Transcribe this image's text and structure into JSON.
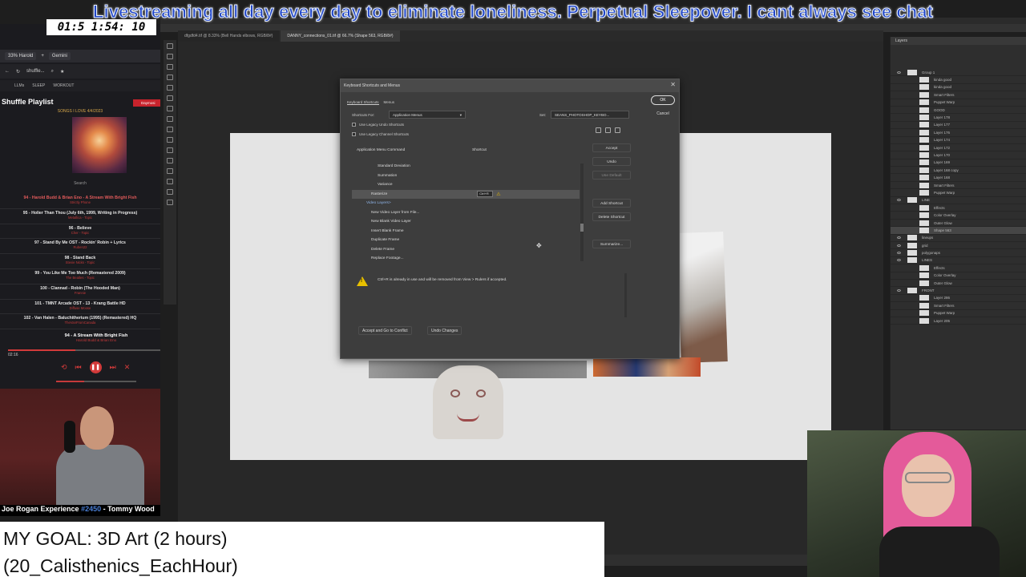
{
  "banner": {
    "text": "Livestreaming all day every day to eliminate loneliness. Perpetual Sleepover. I cant always see chat",
    "color": "#2146c7"
  },
  "timer": {
    "value": "01:5 1:54: 10"
  },
  "browser": {
    "tabs": [
      "33% Harold",
      "Gemini"
    ],
    "nav_text": "shuffle...",
    "bookmarks": [
      "LLMs",
      "SLEEP",
      "WORKOUT"
    ]
  },
  "playlist": {
    "title": "Shuffle Playlist",
    "badge": "Daymosi",
    "caption": "SONGS I LOVE 4/4/2023",
    "search_label": "Search",
    "tracks": [
      {
        "title": "94 - Harold Budd & Brian Eno - A Stream With Bright Fish",
        "artist": "Strictly Phone",
        "current": true
      },
      {
        "title": "95 - Holier Than Thou (July 6th, 1999, Writing in Progress)",
        "artist": "Metallica - Topic"
      },
      {
        "title": "96 - Believe",
        "artist": "Cher - Topic"
      },
      {
        "title": "97 - Stand By Me OST - Rockin' Robin + Lyrics",
        "artist": "Ruben22"
      },
      {
        "title": "98 - Stand Back",
        "artist": "Stevie Nicks - Topic"
      },
      {
        "title": "99 - You Like Me Too Much (Remastered 2009)",
        "artist": "The Beatles - Topic"
      },
      {
        "title": "100 - Clannad - Robin (The Hooded Man)",
        "artist": "Frannie"
      },
      {
        "title": "101 - TMNT Arcade OST - 13 - Krang Battle HD",
        "artist": "Diffuse Moose"
      },
      {
        "title": "102 - Van Halen - Baluchitherium (1995) (Remastered) HQ",
        "artist": "TheVanFromCanada"
      }
    ],
    "now_playing_title": "94 - A Stream With Bright Fish",
    "now_playing_artist": "Harold Budd & Brian Eno",
    "elapsed": "02:16",
    "progress": 0.44,
    "volume": 0.35,
    "accent": "#d23a3a"
  },
  "podcast": {
    "show": "Joe Rogan Experience",
    "episode": "#2450",
    "guest": "- Tommy Wood"
  },
  "goal": {
    "line1": "MY GOAL: 3D Art (2 hours)",
    "line2": "(20_Calisthenics_EachHour)"
  },
  "photoshop": {
    "doc_tabs": [
      "dfgdfd4.tif @ 8.33% (Bell Hands elbows, RGB/8#)",
      "DANNY_connections_01.tif @ 66.7% (Shape 563, RGB/8#)"
    ],
    "layers_title": "Layers",
    "layers": [
      {
        "name": "Group 1",
        "sub": false
      },
      {
        "name": "kinda good",
        "sub": true
      },
      {
        "name": "kinda good",
        "sub": true
      },
      {
        "name": "Smart Filters",
        "sub": true
      },
      {
        "name": "Puppet Warp",
        "sub": true
      },
      {
        "name": "GOOD",
        "sub": true
      },
      {
        "name": "Layer 178",
        "sub": true
      },
      {
        "name": "Layer 177",
        "sub": true
      },
      {
        "name": "Layer 176",
        "sub": true
      },
      {
        "name": "Layer 174",
        "sub": true
      },
      {
        "name": "Layer 172",
        "sub": true
      },
      {
        "name": "Layer 170",
        "sub": true
      },
      {
        "name": "Layer 169",
        "sub": true
      },
      {
        "name": "Layer 168 copy",
        "sub": true
      },
      {
        "name": "Layer 168",
        "sub": true
      },
      {
        "name": "Smart Filters",
        "sub": true
      },
      {
        "name": "Puppet Warp",
        "sub": true
      },
      {
        "name": "LINE",
        "sub": false
      },
      {
        "name": "Effects",
        "sub": true
      },
      {
        "name": "Color Overlay",
        "sub": true
      },
      {
        "name": "Outer Glow",
        "sub": true
      },
      {
        "name": "Shape 563",
        "sub": true,
        "selected": true
      },
      {
        "name": "lineups",
        "sub": false
      },
      {
        "name": "grid",
        "sub": false
      },
      {
        "name": "polygonaps",
        "sub": false
      },
      {
        "name": "LINES",
        "sub": false
      },
      {
        "name": "Effects",
        "sub": true
      },
      {
        "name": "Color Overlay",
        "sub": true
      },
      {
        "name": "Outer Glow",
        "sub": true
      },
      {
        "name": "FRONT",
        "sub": false
      },
      {
        "name": "Layer 286",
        "sub": true
      },
      {
        "name": "Smart Filters",
        "sub": true
      },
      {
        "name": "Puppet Warp",
        "sub": true
      },
      {
        "name": "Layer 205",
        "sub": true
      }
    ]
  },
  "dialog": {
    "title": "Keyboard Shortcuts and Menus",
    "tabs": [
      "Keyboard Shortcuts",
      "Menus"
    ],
    "shortcuts_for_label": "Shortcuts For:",
    "shortcuts_for_value": "Application Menus",
    "set_label": "Set:",
    "set_value": "SEANS_PHOTOSHOP_KEYBO...",
    "check_undo": "Use Legacy Undo Shortcuts",
    "check_channel": "Use Legacy Channel Shortcuts",
    "col_command": "Application Menu Command",
    "col_shortcut": "Shortcut",
    "commands": [
      {
        "label": "Standard Deviation",
        "level": "lvl1"
      },
      {
        "label": "Summation",
        "level": "lvl1"
      },
      {
        "label": "Variance",
        "level": "lvl1"
      },
      {
        "label": "Rasterize",
        "level": "lvl2",
        "selected": true,
        "shortcut": "Ctrl+R",
        "warn": true
      },
      {
        "label": "Video Layers>",
        "level": "lvl0"
      },
      {
        "label": "New Video Layer from File...",
        "level": "lvl2"
      },
      {
        "label": "New Blank Video Layer",
        "level": "lvl2"
      },
      {
        "label": "Insert Blank Frame",
        "level": "lvl2"
      },
      {
        "label": "Duplicate Frame",
        "level": "lvl2"
      },
      {
        "label": "Delete Frame",
        "level": "lvl2"
      },
      {
        "label": "Replace Footage...",
        "level": "lvl2"
      }
    ],
    "buttons": {
      "ok": "OK",
      "cancel": "Cancel",
      "accept": "Accept",
      "undo": "Undo",
      "use_default": "Use Default",
      "add_shortcut": "Add Shortcut",
      "delete_shortcut": "Delete Shortcut",
      "summarize": "Summarize...",
      "accept_goto": "Accept and Go to Conflict",
      "undo_changes": "Undo Changes"
    },
    "warning": "Ctrl+R is already in use and will be removed from View > Rulers if accepted."
  }
}
